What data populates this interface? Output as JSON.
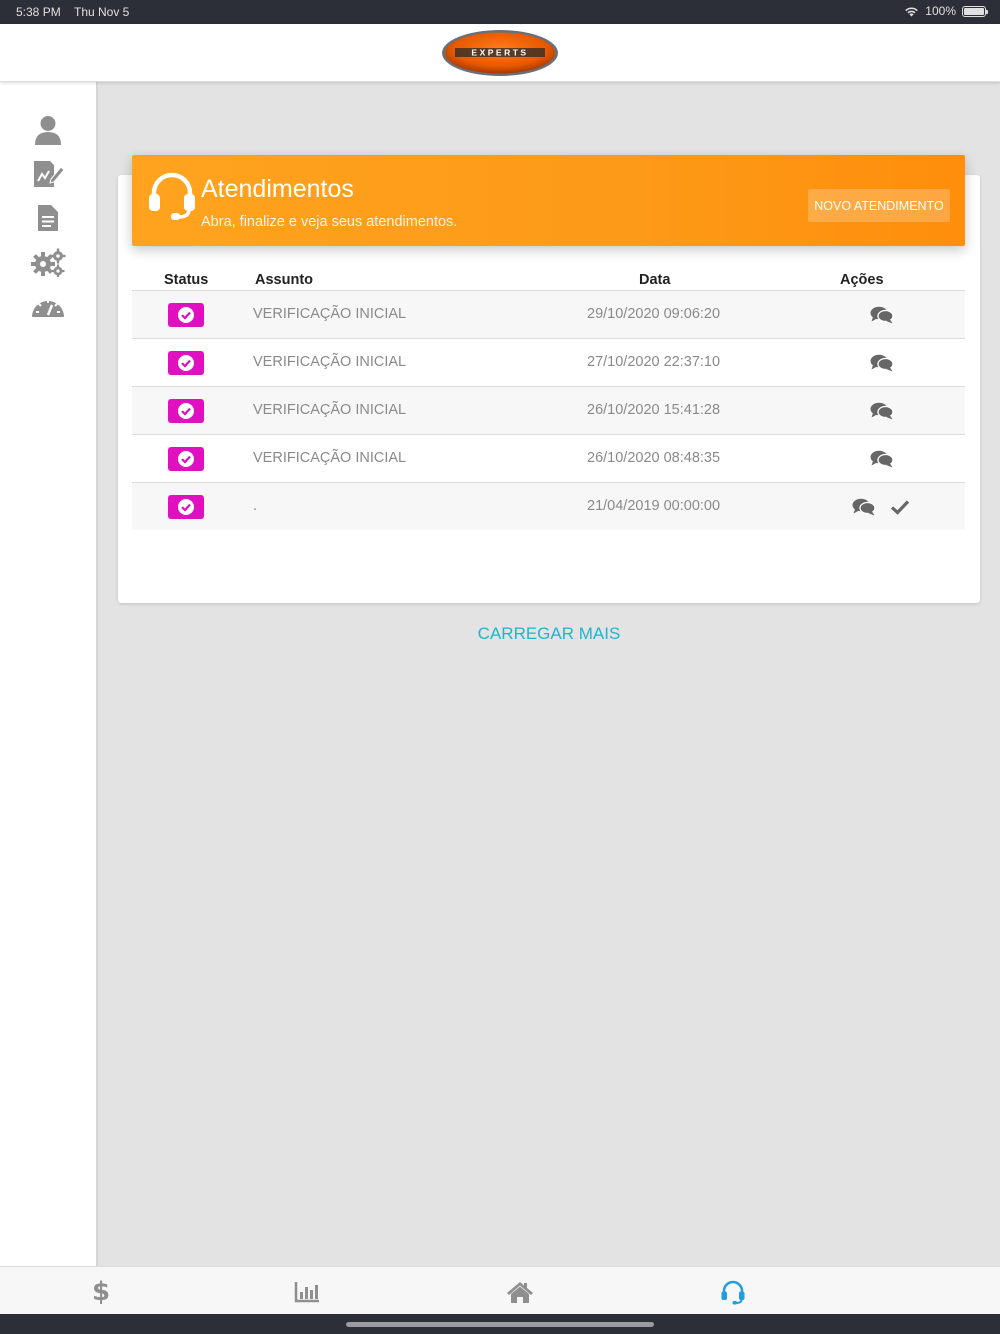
{
  "status_bar": {
    "time": "5:38 PM",
    "date": "Thu Nov 5",
    "battery": "100%"
  },
  "header": {
    "logo_text": "EXPERTS",
    "logo_color": "#e85a00"
  },
  "sidebar": {
    "items": [
      {
        "icon": "user-icon"
      },
      {
        "icon": "edit-document-icon"
      },
      {
        "icon": "document-icon"
      },
      {
        "icon": "gears-icon"
      },
      {
        "icon": "dashboard-gauge-icon"
      }
    ]
  },
  "banner": {
    "title": "Atendimentos",
    "subtitle": "Abra, finalize e veja seus atendimentos.",
    "button_label": "NOVO ATENDIMENTO",
    "color": "#fd9a17"
  },
  "table": {
    "headers": {
      "status": "Status",
      "assunto": "Assunto",
      "data": "Data",
      "acoes": "Ações"
    },
    "rows": [
      {
        "assunto": "VERIFICAÇÃO INICIAL",
        "data": "29/10/2020 09:06:20"
      },
      {
        "assunto": "VERIFICAÇÃO INICIAL",
        "data": "27/10/2020 22:37:10"
      },
      {
        "assunto": "VERIFICAÇÃO INICIAL",
        "data": "26/10/2020 15:41:28"
      },
      {
        "assunto": "VERIFICAÇÃO INICIAL",
        "data": "26/10/2020 08:48:35"
      },
      {
        "assunto": ".",
        "data": "21/04/2019 00:00:00"
      }
    ],
    "status_color": "#e010c0"
  },
  "load_more": "CARREGAR MAIS",
  "tabbar": {
    "items": [
      {
        "icon": "dollar-icon",
        "glyph": "$"
      },
      {
        "icon": "bar-chart-icon"
      },
      {
        "icon": "home-icon"
      },
      {
        "icon": "headset-icon",
        "active": true
      }
    ],
    "active_color": "#1e9ee0"
  }
}
